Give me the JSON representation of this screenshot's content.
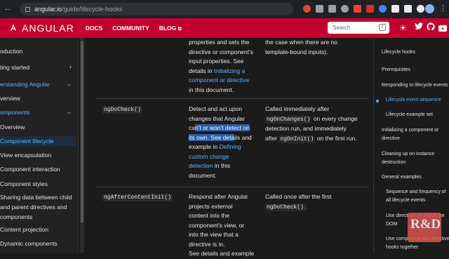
{
  "browser": {
    "url_host": "angular.io",
    "url_path": "/guide/lifecycle-hooks",
    "ext_colors": [
      "#e94335",
      "#9aa0a6",
      "#9aa0a6",
      "#9aa0a6",
      "#ea4335",
      "#d93025",
      "#4285f4",
      "#e8eaed",
      "#e8eaed",
      "#e8eaed"
    ]
  },
  "header": {
    "brand": "ANGULAR",
    "nav": [
      "DOCS",
      "COMMUNITY",
      "BLOG"
    ],
    "blog_icon": "external-link-icon",
    "search_placeholder": "Search",
    "search_key": "/",
    "icons": [
      "theme-toggle-icon",
      "twitter-icon",
      "github-icon",
      "youtube-icon"
    ],
    "brand_color": "#c3002f"
  },
  "sidebar": {
    "items": [
      {
        "label": "oduction",
        "chevron": "",
        "state": ""
      },
      {
        "label": "ting started",
        "chevron": "›",
        "state": ""
      },
      {
        "label": "erstanding Angular",
        "chevron": "⌄",
        "state": "active"
      },
      {
        "label": "verview",
        "chevron": "",
        "state": ""
      },
      {
        "label": "omponents",
        "chevron": "⌄",
        "state": "active"
      },
      {
        "label": "Overview",
        "chevron": "",
        "state": ""
      },
      {
        "label": "Component lifecycle",
        "chevron": "",
        "state": "current"
      },
      {
        "label": "View encapsulation",
        "chevron": "",
        "state": ""
      },
      {
        "label": "Component interaction",
        "chevron": "",
        "state": ""
      },
      {
        "label": "Component styles",
        "chevron": "",
        "state": ""
      },
      {
        "label": "Sharing data between child",
        "chevron": "",
        "state": ""
      },
      {
        "label": "and parent directives and",
        "chevron": "",
        "state": ""
      },
      {
        "label": "components",
        "chevron": "",
        "state": ""
      },
      {
        "label": "Content projection",
        "chevron": "",
        "state": ""
      },
      {
        "label": "Dynamic components",
        "chevron": "",
        "state": ""
      }
    ]
  },
  "table": {
    "row0": {
      "purpose_lines": [
        "properties and sets the",
        "directive or component's",
        "input properties. See",
        "details in",
        "Initializing a",
        "component or directive",
        "in this document."
      ],
      "timing_lines": [
        "the case when there are no",
        "template-bound inputs)."
      ]
    },
    "row1": {
      "hook": "ngDoCheck()",
      "purpose": {
        "l1": "Detect and act upon",
        "l2": "changes that Angular",
        "l3a": "ca",
        "l3b": "n't or won't detect on",
        "l4a": "its own. See deta",
        "l4b": "ils and",
        "l5a": "example in",
        "l5b": "Defining",
        "l6": "custom change",
        "l7a": "detection",
        "l7b": "in this",
        "l8": "document."
      },
      "timing": {
        "l1": "Called immediately after",
        "code1": "ngOnChanges()",
        "l2": "on every change",
        "l3": "detection run, and immediately",
        "l4a": "after",
        "code2": "ngOnInit()",
        "l4b": "on the first run."
      }
    },
    "row2": {
      "hook": "ngAfterContentInit()",
      "purpose_lines": [
        "Respond after Angular",
        "projects external",
        "content into the",
        "component's view, or",
        "into the view that a",
        "directive is in.",
        "See details and example"
      ],
      "timing": {
        "l1a": "Called",
        "l1em": "once",
        "l1b": "after the first",
        "code": "ngDoCheck()",
        "dot": "."
      }
    }
  },
  "toc": {
    "items": [
      {
        "label": "Lifecycle hooks",
        "sub": false,
        "active": false
      },
      {
        "label": "Prerequisites",
        "sub": false,
        "active": false
      },
      {
        "label": "Responding to lifecycle events",
        "sub": false,
        "active": false
      },
      {
        "label": "Lifecycle event sequence",
        "sub": true,
        "active": true
      },
      {
        "label": "Lifecycle example set",
        "sub": true,
        "active": false
      },
      {
        "label": "Initializing a component or",
        "sub": false,
        "active": false
      },
      {
        "label": "directive",
        "sub": false,
        "active": false
      },
      {
        "label": "Cleaning up on instance",
        "sub": false,
        "active": false
      },
      {
        "label": "destruction",
        "sub": false,
        "active": false
      },
      {
        "label": "General examples",
        "sub": false,
        "active": false
      },
      {
        "label": "Sequence and frequency of",
        "sub": true,
        "active": false
      },
      {
        "label": "all lifecycle events",
        "sub": true,
        "active": false
      },
      {
        "label": "Use directives to watch the",
        "sub": true,
        "active": false
      },
      {
        "label": "DOM",
        "sub": true,
        "active": false
      },
      {
        "label": "Use component and directive",
        "sub": true,
        "active": false
      },
      {
        "label": "hooks together",
        "sub": true,
        "active": false
      }
    ]
  },
  "watermark": {
    "text": "R&D"
  }
}
